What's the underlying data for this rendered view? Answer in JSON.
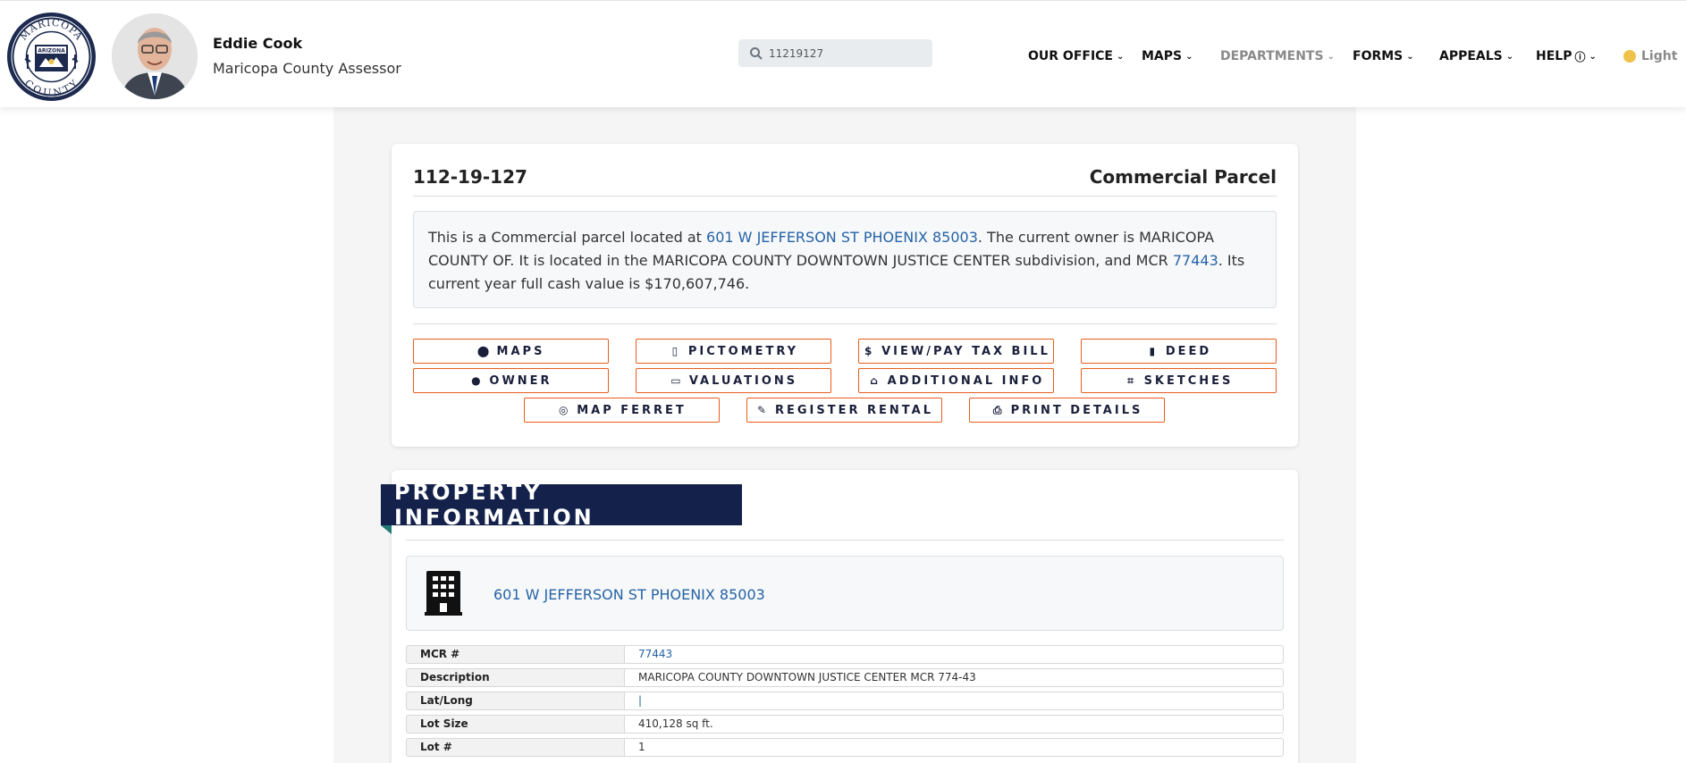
{
  "header": {
    "seal": {
      "top_text": "MARICOPA",
      "middle_text": "ARIZONA",
      "bottom_text": "COUNTY"
    },
    "assessor_name": "Eddie Cook",
    "assessor_title": "Maricopa County Assessor",
    "search": {
      "value": "11219127",
      "icon": "search-icon"
    },
    "nav": [
      {
        "label": "OUR OFFICE"
      },
      {
        "label": "MAPS"
      },
      {
        "label": "DEPARTMENTS"
      },
      {
        "label": "FORMS"
      },
      {
        "label": "APPEALS"
      },
      {
        "label": "HELP"
      }
    ],
    "theme_toggle": "Light"
  },
  "parcel": {
    "number": "112-19-127",
    "type": "Commercial Parcel",
    "summary": {
      "text1": "This is a Commercial parcel located at ",
      "address_link": "601 W JEFFERSON ST PHOENIX 85003",
      "text2": ". The current owner is MARICOPA COUNTY OF. It is located in the MARICOPA COUNTY DOWNTOWN JUSTICE CENTER subdivision, and MCR ",
      "mcr_link": "77443",
      "text3": ". Its current year full cash value is $170,607,746."
    }
  },
  "actions": [
    {
      "label": "MAPS",
      "icon": "map-pin-icon"
    },
    {
      "label": "PICTOMETRY",
      "icon": "building-icon"
    },
    {
      "label": "VIEW/PAY TAX BILL",
      "icon": "dollar-icon"
    },
    {
      "label": "DEED",
      "icon": "bookmark-icon"
    },
    {
      "label": "OWNER",
      "icon": "user-icon"
    },
    {
      "label": "VALUATIONS",
      "icon": "money-bill-icon"
    },
    {
      "label": "ADDITIONAL INFO",
      "icon": "home-icon"
    },
    {
      "label": "SKETCHES",
      "icon": "crop-icon"
    },
    {
      "label": "MAP FERRET",
      "icon": "compass-icon"
    },
    {
      "label": "REGISTER RENTAL",
      "icon": "edit-icon"
    },
    {
      "label": "PRINT DETAILS",
      "icon": "print-icon"
    }
  ],
  "property": {
    "heading": "PROPERTY INFORMATION",
    "address": "601 W JEFFERSON ST PHOENIX 85003",
    "rows": [
      {
        "label": "MCR #",
        "value": "77443"
      },
      {
        "label": "Description",
        "value": "MARICOPA COUNTY DOWNTOWN JUSTICE CENTER MCR 774-43"
      },
      {
        "label": "Lat/Long",
        "value": "|"
      },
      {
        "label": "Lot Size",
        "value": "410,128 sq ft."
      },
      {
        "label": "Lot #",
        "value": "1"
      }
    ]
  },
  "colors": {
    "brand_navy": "#13214b",
    "accent_orange": "#e85d1b",
    "link_blue": "#2563a6",
    "ribbon_fold_teal": "#1f7a72"
  }
}
